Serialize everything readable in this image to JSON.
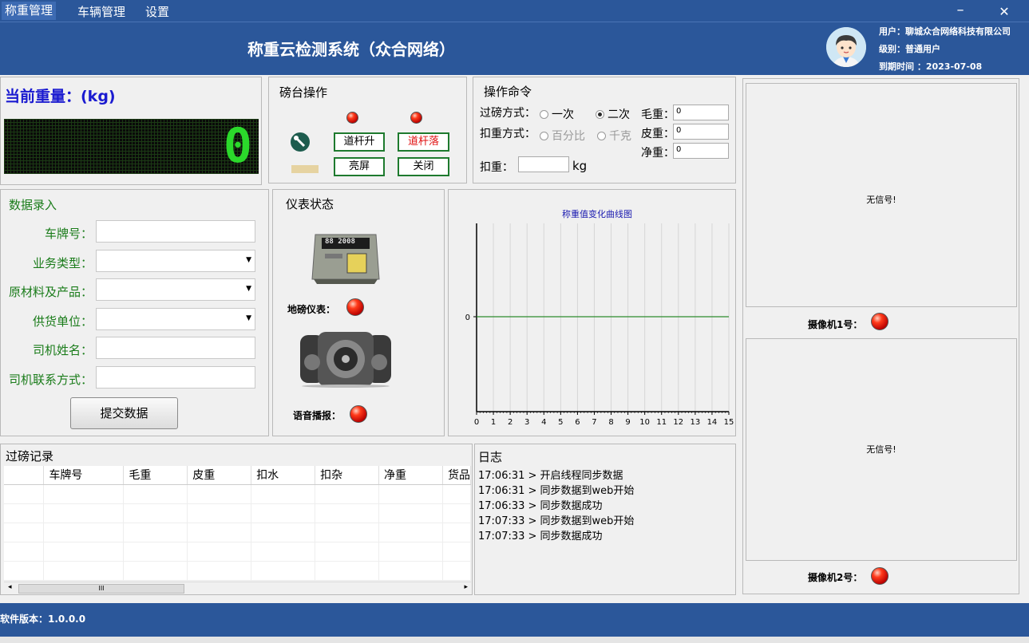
{
  "menu": {
    "items": [
      {
        "label": "称重管理"
      },
      {
        "label": "车辆管理"
      },
      {
        "label": "设置"
      }
    ]
  },
  "window": {
    "minimize": "–",
    "close": "✕"
  },
  "header": {
    "title": "称重云检测系统（众合网络）",
    "user_line": "用户：聊城众合网络科技有限公司",
    "level_line": "级别：普通用户",
    "expire_line": "到期时间 ：2023-07-08"
  },
  "weight": {
    "title": "当前重量：(kg)",
    "value": "0"
  },
  "scale_ops": {
    "title": "磅台操作",
    "gate_up": "道杆升",
    "gate_down": "道杆落",
    "screen_on": "亮屏",
    "screen_off": "关闭"
  },
  "commands": {
    "title": "操作命令",
    "pass_mode_label": "过磅方式：",
    "pass_once": "一次",
    "pass_twice": "二次",
    "deduct_mode_label": "扣重方式：",
    "deduct_percent": "百分比",
    "deduct_kg": "千克",
    "gross_label": "毛重：",
    "gross_value": "0",
    "tare_label": "皮重：",
    "tare_value": "0",
    "net_label": "净重：",
    "net_value": "0",
    "deduct_label": "扣重：",
    "deduct_unit": "kg"
  },
  "data_entry": {
    "title": "数据录入",
    "fields": [
      {
        "label": "车牌号：",
        "value": ""
      },
      {
        "label": "业务类型：",
        "value": ""
      },
      {
        "label": "原材料及产品：",
        "value": ""
      },
      {
        "label": "供货单位：",
        "value": ""
      },
      {
        "label": "司机姓名：",
        "value": ""
      },
      {
        "label": "司机联系方式：",
        "value": ""
      }
    ],
    "submit": "提交数据"
  },
  "instrument": {
    "title": "仪表状态",
    "meter_label": "地磅仪表：",
    "display_text": "88 2008",
    "voice_label": "语音播报："
  },
  "chart_data": {
    "type": "line",
    "title": "称重值变化曲线图",
    "x": [
      0,
      15
    ],
    "series": [
      {
        "values": [
          0,
          0
        ]
      }
    ],
    "xticks": [
      "0",
      "1",
      "2",
      "3",
      "4",
      "5",
      "6",
      "7",
      "8",
      "9",
      "10",
      "11",
      "12",
      "13",
      "14",
      "15"
    ],
    "yticks": [
      "0"
    ],
    "xlim": [
      0,
      15
    ],
    "grid": "vertical",
    "line_color": "#2e8b2e"
  },
  "records": {
    "title": "过磅记录",
    "columns": [
      "车牌号",
      "毛重",
      "皮重",
      "扣水",
      "扣杂",
      "净重",
      "货品"
    ],
    "rows": [],
    "scroll_thumb": "III"
  },
  "log": {
    "title": "日志",
    "entries": [
      "17:06:31 > 开启线程同步数据",
      "17:06:31 > 同步数据到web开始",
      "17:06:33 > 同步数据成功",
      "17:07:33 > 同步数据到web开始",
      "17:07:33 > 同步数据成功"
    ]
  },
  "cameras": [
    {
      "label": "摄像机1号：",
      "status": "无信号!"
    },
    {
      "label": "摄像机2号：",
      "status": "无信号!"
    }
  ],
  "footer": {
    "version": "软件版本：1.0.0.0"
  }
}
